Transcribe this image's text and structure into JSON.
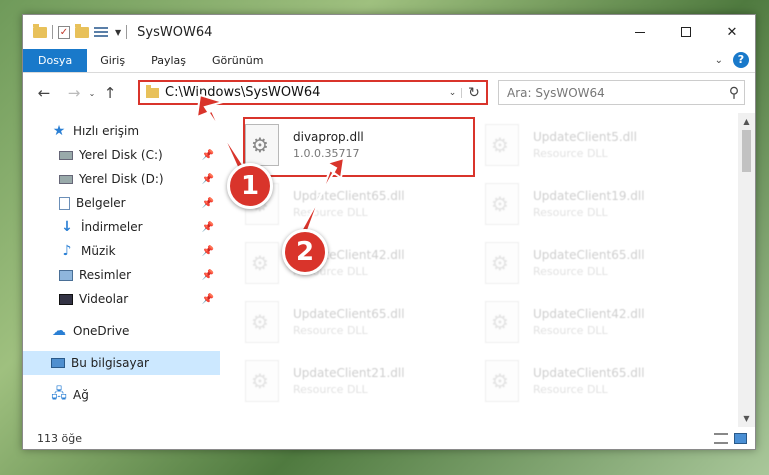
{
  "window": {
    "title": "SysWOW64"
  },
  "ribbon": {
    "tabs": [
      "Dosya",
      "Giriş",
      "Paylaş",
      "Görünüm"
    ],
    "help": "?"
  },
  "nav": {
    "back": "←",
    "forward": "→",
    "recent": "⌄",
    "up": "↑",
    "address": "C:\\Windows\\SysWOW64",
    "search_placeholder": "Ara: SysWOW64"
  },
  "sidebar": {
    "items": [
      {
        "label": "Hızlı erişim",
        "icon": "star-icon"
      },
      {
        "label": "Yerel Disk (C:)",
        "icon": "disk-icon",
        "pinned": true
      },
      {
        "label": "Yerel Disk (D:)",
        "icon": "disk-icon",
        "pinned": true
      },
      {
        "label": "Belgeler",
        "icon": "document-icon",
        "pinned": true
      },
      {
        "label": "İndirmeler",
        "icon": "download-icon",
        "pinned": true
      },
      {
        "label": "Müzik",
        "icon": "music-icon",
        "pinned": true
      },
      {
        "label": "Resimler",
        "icon": "pictures-icon",
        "pinned": true
      },
      {
        "label": "Videolar",
        "icon": "video-icon",
        "pinned": true
      },
      {
        "label": "OneDrive",
        "icon": "cloud-icon"
      },
      {
        "label": "Bu bilgisayar",
        "icon": "computer-icon",
        "selected": true
      },
      {
        "label": "Ağ",
        "icon": "network-icon"
      }
    ]
  },
  "files": [
    {
      "name": "divaprop.dll",
      "meta": "1.0.0.35717",
      "highlight": true
    },
    {
      "name": "UpdateClient5.dll",
      "meta": "Resource DLL"
    },
    {
      "name": "UpdateClient65.dll",
      "meta": "Resource DLL"
    },
    {
      "name": "UpdateClient19.dll",
      "meta": "Resource DLL"
    },
    {
      "name": "UpdateClient42.dll",
      "meta": "Resource DLL"
    },
    {
      "name": "UpdateClient65.dll",
      "meta": "Resource DLL"
    },
    {
      "name": "UpdateClient65.dll",
      "meta": "Resource DLL"
    },
    {
      "name": "UpdateClient42.dll",
      "meta": "Resource DLL"
    },
    {
      "name": "UpdateClient21.dll",
      "meta": "Resource DLL"
    },
    {
      "name": "UpdateClient65.dll",
      "meta": "Resource DLL"
    }
  ],
  "status": {
    "count": "113 öğe"
  },
  "annotations": {
    "badge1": "1",
    "badge2": "2",
    "color": "#d9342b"
  }
}
